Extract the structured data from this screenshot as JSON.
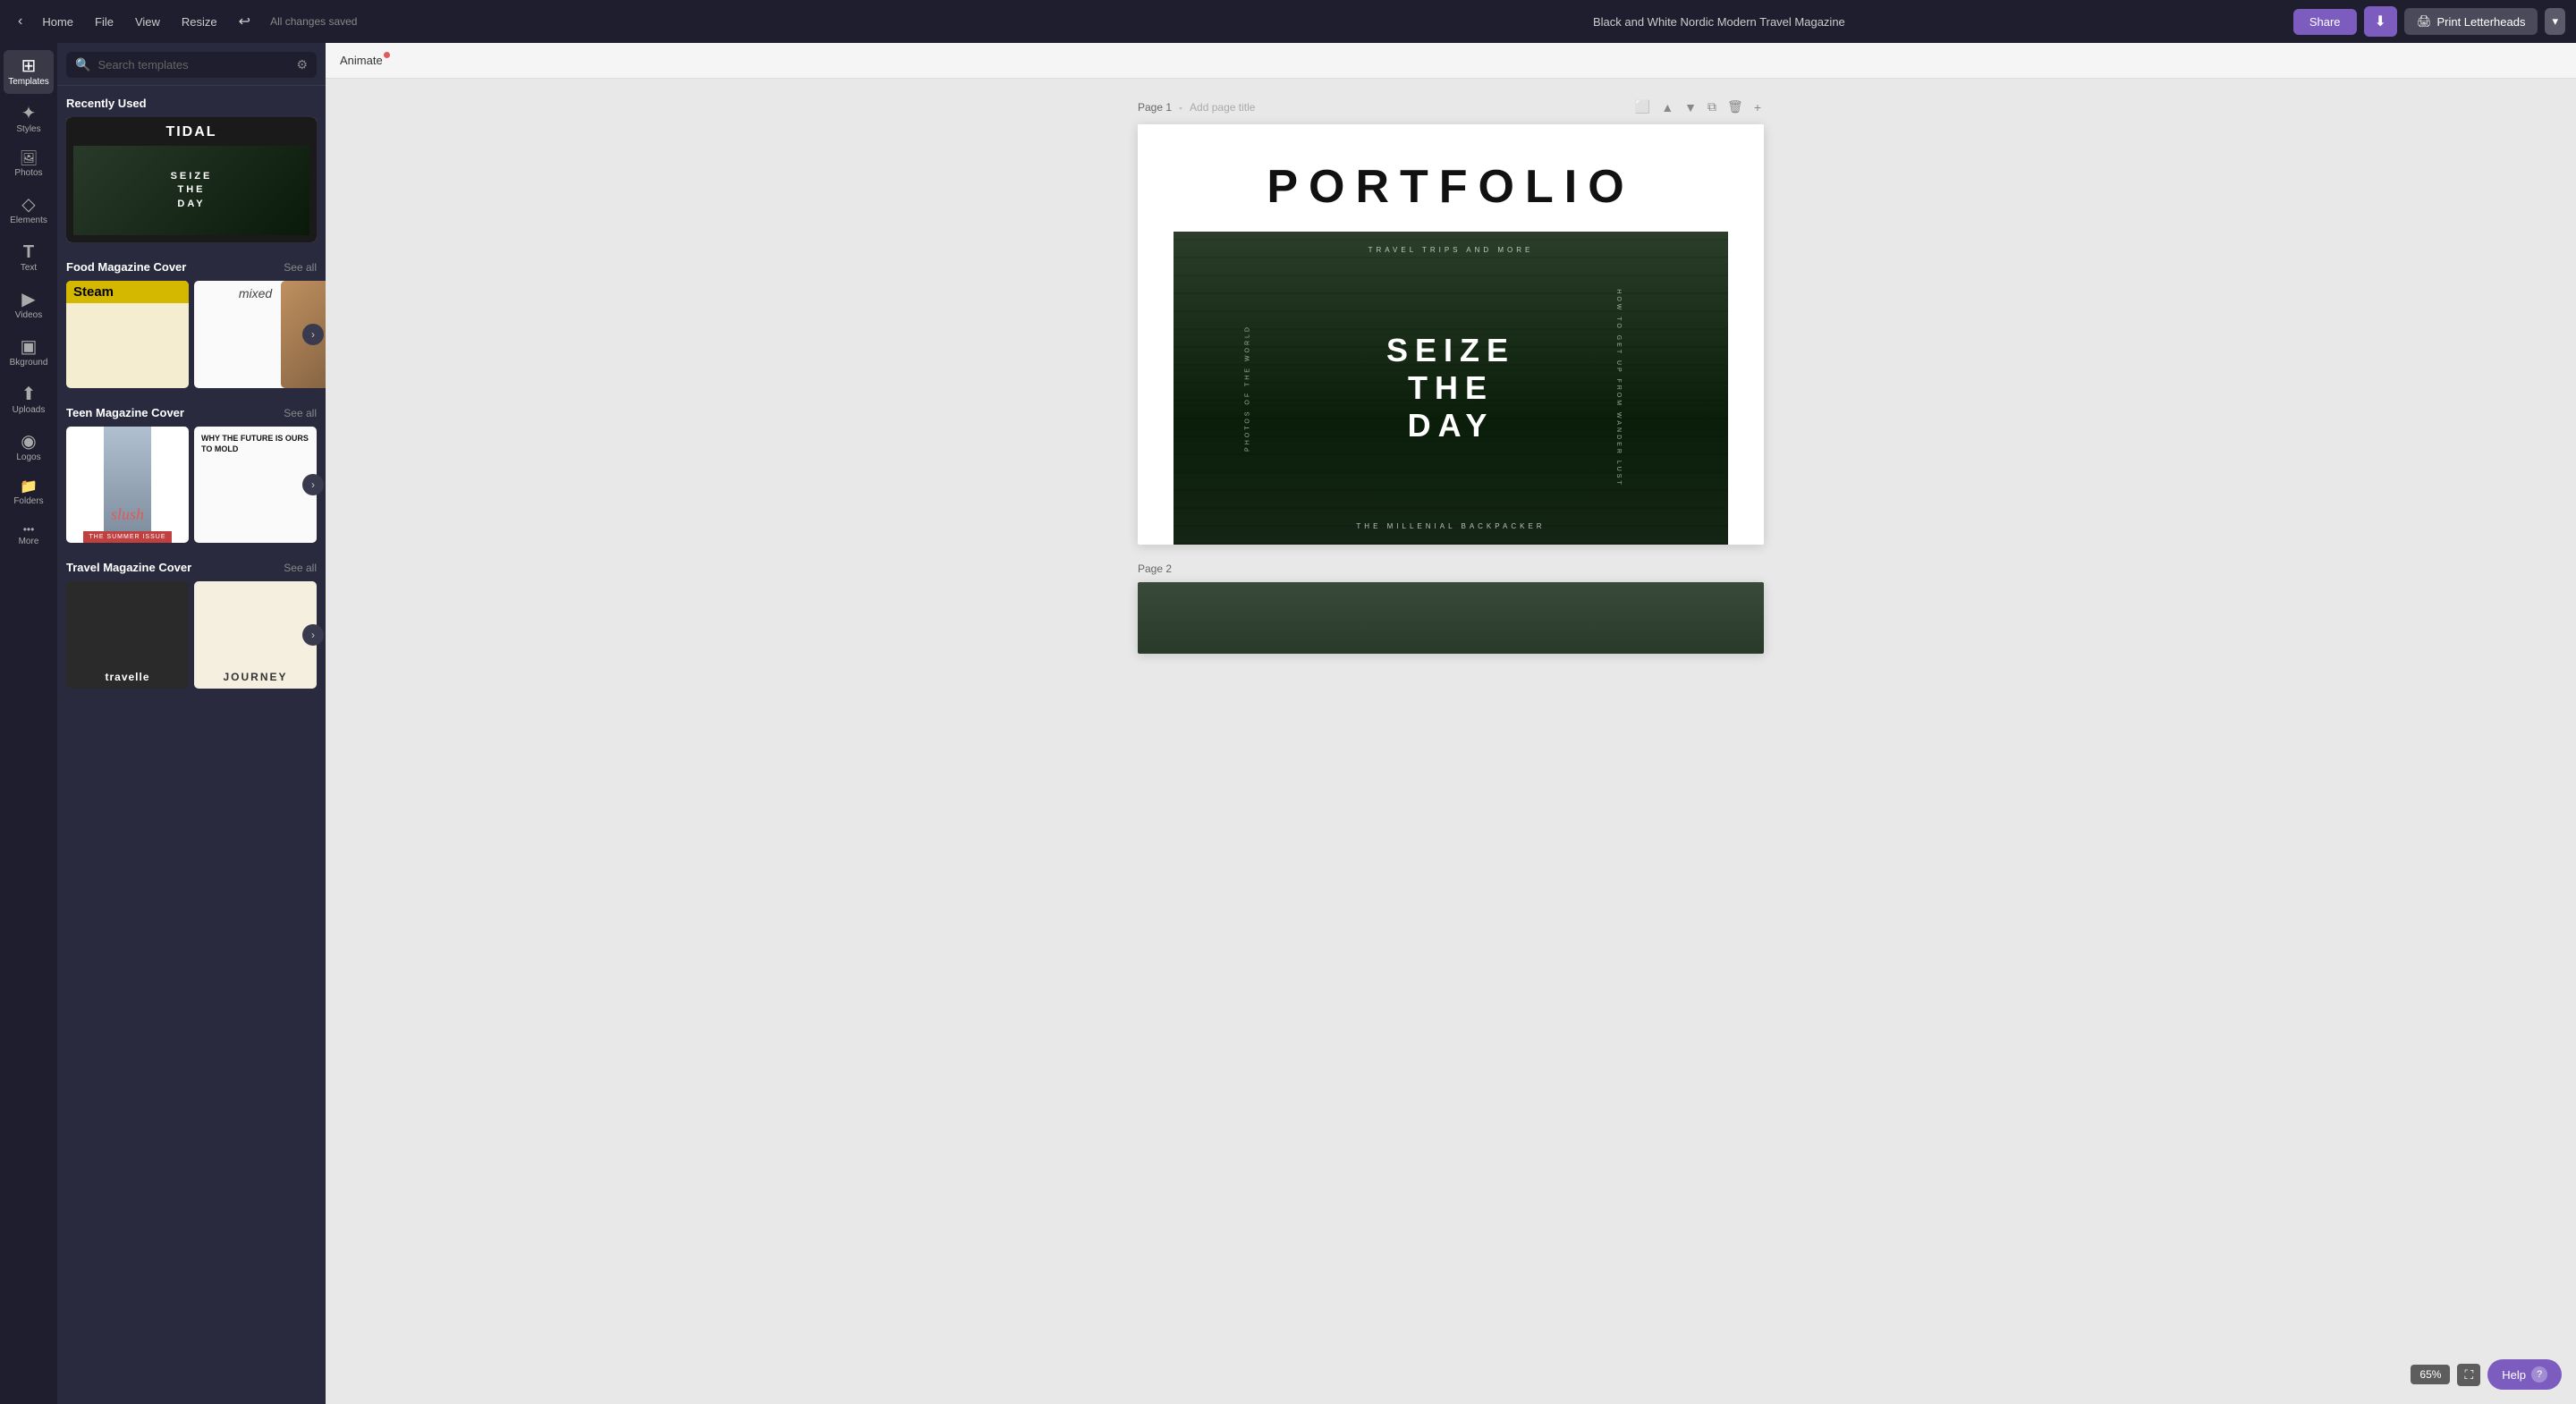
{
  "topbar": {
    "home_label": "Home",
    "file_label": "File",
    "view_label": "View",
    "resize_label": "Resize",
    "undo_icon": "↩",
    "saved_status": "All changes saved",
    "title": "Black and White Nordic Modern Travel Magazine",
    "share_label": "Share",
    "download_icon": "⬇",
    "print_label": "Print Letterheads",
    "print_arrow": "▾"
  },
  "left_sidebar": {
    "items": [
      {
        "id": "templates",
        "icon": "⊞",
        "label": "Templates",
        "active": true
      },
      {
        "id": "styles",
        "icon": "✦",
        "label": "Styles"
      },
      {
        "id": "photos",
        "icon": "🖼",
        "label": "Photos"
      },
      {
        "id": "elements",
        "icon": "◇",
        "label": "Elements"
      },
      {
        "id": "text",
        "icon": "T",
        "label": "Text"
      },
      {
        "id": "videos",
        "icon": "▶",
        "label": "Videos"
      },
      {
        "id": "bkground",
        "icon": "▣",
        "label": "Bkground"
      },
      {
        "id": "uploads",
        "icon": "⬆",
        "label": "Uploads"
      },
      {
        "id": "logos",
        "icon": "◉",
        "label": "Logos"
      },
      {
        "id": "folders",
        "icon": "📁",
        "label": "Folders"
      },
      {
        "id": "more",
        "icon": "•••",
        "label": "More"
      }
    ]
  },
  "templates_panel": {
    "search_placeholder": "Search templates",
    "recently_used_label": "Recently Used",
    "food_magazine_label": "Food Magazine Cover",
    "food_see_all": "See all",
    "teen_magazine_label": "Teen Magazine Cover",
    "teen_see_all": "See all",
    "travel_magazine_label": "Travel Magazine Cover",
    "travel_see_all": "See all",
    "templates": {
      "recently_used": {
        "title": "TIDAL",
        "subtitle": "SEIZE\nTHE\nDAY"
      },
      "food": [
        {
          "id": "steam",
          "badge": "Steam",
          "style": "steam"
        },
        {
          "id": "mixed",
          "title": "mixed",
          "style": "mixed"
        },
        {
          "id": "food3",
          "style": "food3"
        }
      ],
      "teen": [
        {
          "id": "slush",
          "title": "slush",
          "style": "slush"
        },
        {
          "id": "why",
          "title": "WHY THE FUTURE IS OURS TO MOLD",
          "style": "why"
        },
        {
          "id": "teen3",
          "style": "teen3"
        }
      ],
      "travel": [
        {
          "id": "travelle",
          "title": "travelle",
          "style": "travelle"
        },
        {
          "id": "journey",
          "title": "JOURNEY",
          "style": "journey"
        }
      ]
    }
  },
  "animate_bar": {
    "label": "Animate"
  },
  "canvas": {
    "page1": {
      "label": "Page 1",
      "add_title_placeholder": "Add page title",
      "portfolio_title": "PORTFOLIO",
      "travel_trips": "TRAVEL TRIPS AND MORE",
      "side_left": "PHOTOS OF THE WORLD",
      "side_right": "HOW TO GET UP FROM WANDER LUST",
      "seize": "SEIZE",
      "the": "THE",
      "day": "DAY",
      "millenial": "THE MILLENIAL BACKPACKER"
    },
    "page2": {
      "label": "Page 2"
    }
  },
  "bottom": {
    "zoom": "65%",
    "help_label": "Help",
    "help_icon": "?"
  }
}
